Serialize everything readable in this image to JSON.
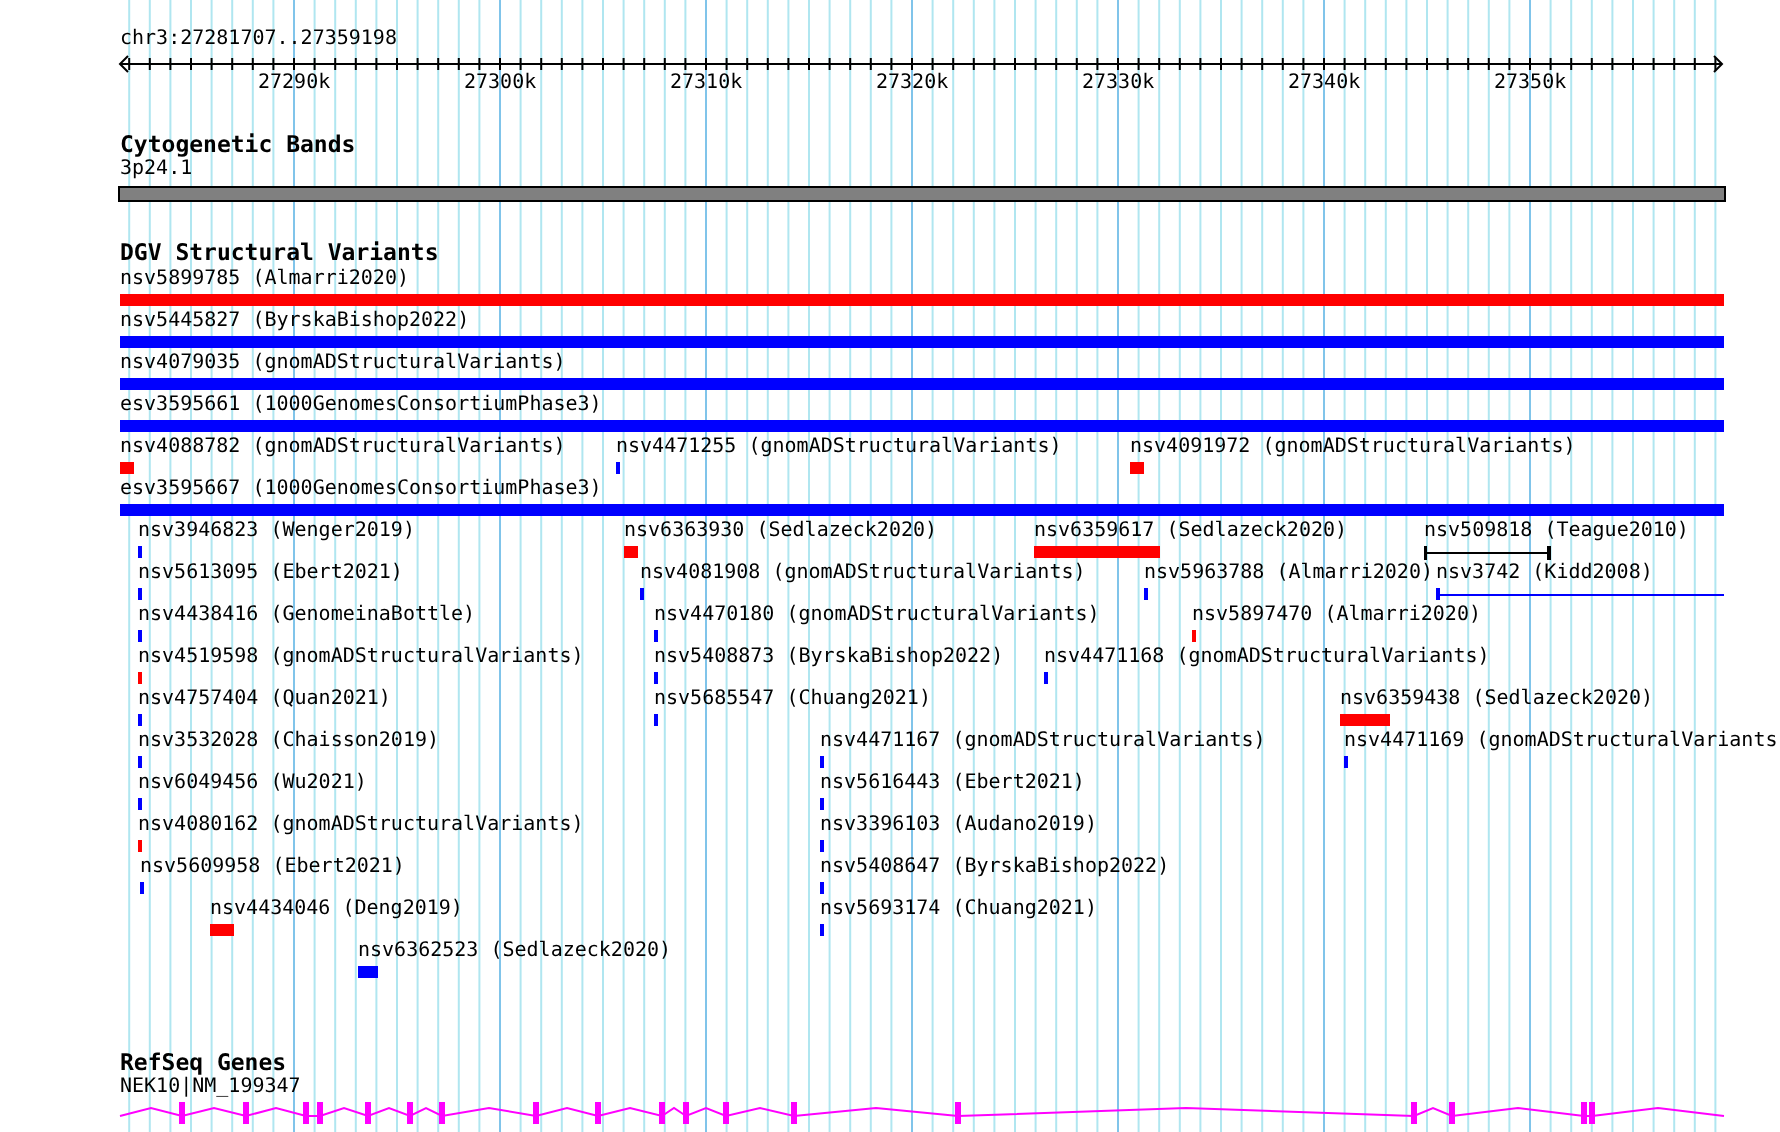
{
  "ruler": {
    "location": "chr3:27281707..27359198",
    "ticks": [
      "27290k",
      "27300k",
      "27310k",
      "27320k",
      "27330k",
      "27340k",
      "27350k"
    ]
  },
  "cytobands": {
    "title": "Cytogenetic Bands",
    "features": [
      {
        "label": "3p24.1",
        "color": "#808080"
      }
    ]
  },
  "variants": {
    "title": "DGV Structural Variants",
    "features": [
      {
        "label": "nsv5899785 (Almarri2020)",
        "kind": "bar",
        "color": "#ff0000"
      },
      {
        "label": "nsv5445827 (ByrskaBishop2022)",
        "kind": "bar",
        "color": "#0000ff"
      },
      {
        "label": "nsv4079035 (gnomADStructuralVariants)",
        "kind": "bar",
        "color": "#0000ff"
      },
      {
        "label": "esv3595661 (1000GenomesConsortiumPhase3)",
        "kind": "bar",
        "color": "#0000ff"
      },
      {
        "label": "nsv4088782 (gnomADStructuralVariants)",
        "kind": "bar",
        "color": "#ff0000"
      },
      {
        "label": "nsv4471255 (gnomADStructuralVariants)",
        "kind": "bar",
        "color": "#0000ff"
      },
      {
        "label": "nsv4091972 (gnomADStructuralVariants)",
        "kind": "bar",
        "color": "#ff0000"
      },
      {
        "label": "esv3595667 (1000GenomesConsortiumPhase3)",
        "kind": "bar",
        "color": "#0000ff"
      },
      {
        "label": "nsv3946823 (Wenger2019)",
        "kind": "bar",
        "color": "#0000ff"
      },
      {
        "label": "nsv6363930 (Sedlazeck2020)",
        "kind": "bar",
        "color": "#ff0000"
      },
      {
        "label": "nsv6359617 (Sedlazeck2020)",
        "kind": "bar",
        "color": "#ff0000"
      },
      {
        "label": "nsv509818 (Teague2010)",
        "kind": "range",
        "color": "#000000"
      },
      {
        "label": "nsv5613095 (Ebert2021)",
        "kind": "bar",
        "color": "#0000ff"
      },
      {
        "label": "nsv4081908 (gnomADStructuralVariants)",
        "kind": "bar",
        "color": "#0000ff"
      },
      {
        "label": "nsv5963788 (Almarri2020)",
        "kind": "bar",
        "color": "#0000ff"
      },
      {
        "label": "nsv3742 (Kidd2008)",
        "kind": "line",
        "color": "#0000ff"
      },
      {
        "label": "nsv4438416 (GenomeinaBottle)",
        "kind": "bar",
        "color": "#0000ff"
      },
      {
        "label": "nsv4470180 (gnomADStructuralVariants)",
        "kind": "bar",
        "color": "#0000ff"
      },
      {
        "label": "nsv5897470 (Almarri2020)",
        "kind": "bar",
        "color": "#ff0000"
      },
      {
        "label": "nsv4519598 (gnomADStructuralVariants)",
        "kind": "bar",
        "color": "#ff0000"
      },
      {
        "label": "nsv5408873 (ByrskaBishop2022)",
        "kind": "bar",
        "color": "#0000ff"
      },
      {
        "label": "nsv4471168 (gnomADStructuralVariants)",
        "kind": "bar",
        "color": "#0000ff"
      },
      {
        "label": "nsv4757404 (Quan2021)",
        "kind": "bar",
        "color": "#0000ff"
      },
      {
        "label": "nsv5685547 (Chuang2021)",
        "kind": "bar",
        "color": "#0000ff"
      },
      {
        "label": "nsv6359438 (Sedlazeck2020)",
        "kind": "bar",
        "color": "#ff0000"
      },
      {
        "label": "nsv3532028 (Chaisson2019)",
        "kind": "bar",
        "color": "#0000ff"
      },
      {
        "label": "nsv4471167 (gnomADStructuralVariants)",
        "kind": "bar",
        "color": "#0000ff"
      },
      {
        "label": "nsv4471169 (gnomADStructuralVariants",
        "kind": "bar",
        "color": "#0000ff"
      },
      {
        "label": "nsv6049456 (Wu2021)",
        "kind": "bar",
        "color": "#0000ff"
      },
      {
        "label": "nsv5616443 (Ebert2021)",
        "kind": "bar",
        "color": "#0000ff"
      },
      {
        "label": "nsv4080162 (gnomADStructuralVariants)",
        "kind": "bar",
        "color": "#ff0000"
      },
      {
        "label": "nsv3396103 (Audano2019)",
        "kind": "bar",
        "color": "#0000ff"
      },
      {
        "label": "nsv5609958 (Ebert2021)",
        "kind": "bar",
        "color": "#0000ff"
      },
      {
        "label": "nsv5408647 (ByrskaBishop2022)",
        "kind": "bar",
        "color": "#0000ff"
      },
      {
        "label": "nsv4434046 (Deng2019)",
        "kind": "bar",
        "color": "#ff0000"
      },
      {
        "label": "nsv5693174 (Chuang2021)",
        "kind": "bar",
        "color": "#0000ff"
      },
      {
        "label": "nsv6362523 (Sedlazeck2020)",
        "kind": "bar",
        "color": "#0000ff"
      }
    ]
  },
  "genes": {
    "title": "RefSeq Genes",
    "features": [
      {
        "label": "NEK10|NM_199347",
        "color": "#ff00ff"
      }
    ]
  }
}
